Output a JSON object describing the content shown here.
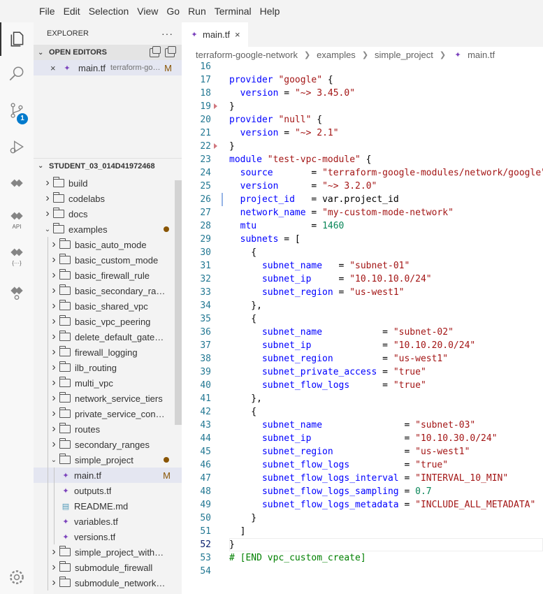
{
  "menu": [
    "File",
    "Edit",
    "Selection",
    "View",
    "Go",
    "Run",
    "Terminal",
    "Help"
  ],
  "activity": {
    "scm_badge": "1",
    "api_label": "API",
    "code_label": "{···}"
  },
  "explorer": {
    "title": "EXPLORER",
    "more": "···",
    "open_editors_title": "OPEN EDITORS",
    "open_editor": {
      "close": "×",
      "name": "main.tf",
      "desc": "terraform-google-network\\examples\\simple_project",
      "status": "M"
    },
    "project_title": "STUDENT_03_014D41972468"
  },
  "tree": [
    {
      "label": "build",
      "type": "folder",
      "depth": 0,
      "open": false
    },
    {
      "label": "codelabs",
      "type": "folder",
      "depth": 0,
      "open": false
    },
    {
      "label": "docs",
      "type": "folder",
      "depth": 0,
      "open": false
    },
    {
      "label": "examples",
      "type": "folder",
      "depth": 0,
      "open": true,
      "dot": true
    },
    {
      "label": "basic_auto_mode",
      "type": "folder",
      "depth": 1,
      "open": false
    },
    {
      "label": "basic_custom_mode",
      "type": "folder",
      "depth": 1,
      "open": false
    },
    {
      "label": "basic_firewall_rule",
      "type": "folder",
      "depth": 1,
      "open": false
    },
    {
      "label": "basic_secondary_ranges",
      "type": "folder",
      "depth": 1,
      "open": false
    },
    {
      "label": "basic_shared_vpc",
      "type": "folder",
      "depth": 1,
      "open": false
    },
    {
      "label": "basic_vpc_peering",
      "type": "folder",
      "depth": 1,
      "open": false
    },
    {
      "label": "delete_default_gateway_routes",
      "type": "folder",
      "depth": 1,
      "open": false
    },
    {
      "label": "firewall_logging",
      "type": "folder",
      "depth": 1,
      "open": false
    },
    {
      "label": "ilb_routing",
      "type": "folder",
      "depth": 1,
      "open": false
    },
    {
      "label": "multi_vpc",
      "type": "folder",
      "depth": 1,
      "open": false
    },
    {
      "label": "network_service_tiers",
      "type": "folder",
      "depth": 1,
      "open": false
    },
    {
      "label": "private_service_connect",
      "type": "folder",
      "depth": 1,
      "open": false
    },
    {
      "label": "routes",
      "type": "folder",
      "depth": 1,
      "open": false
    },
    {
      "label": "secondary_ranges",
      "type": "folder",
      "depth": 1,
      "open": false
    },
    {
      "label": "simple_project",
      "type": "folder",
      "depth": 1,
      "open": true,
      "dot": true
    },
    {
      "label": "main.tf",
      "type": "tf",
      "depth": 2,
      "selected": true,
      "status": "M"
    },
    {
      "label": "outputs.tf",
      "type": "tf",
      "depth": 2
    },
    {
      "label": "README.md",
      "type": "md",
      "depth": 2
    },
    {
      "label": "variables.tf",
      "type": "tf",
      "depth": 2
    },
    {
      "label": "versions.tf",
      "type": "tf",
      "depth": 2
    },
    {
      "label": "simple_project_with_regional_network",
      "type": "folder",
      "depth": 1,
      "open": false
    },
    {
      "label": "submodule_firewall",
      "type": "folder",
      "depth": 1,
      "open": false
    },
    {
      "label": "submodule_network_peering",
      "type": "folder",
      "depth": 1,
      "open": false
    }
  ],
  "tab": {
    "name": "main.tf",
    "close": "×"
  },
  "breadcrumb": [
    "terraform-google-network",
    "examples",
    "simple_project",
    "main.tf"
  ],
  "editor": {
    "current_line": 52,
    "lines": [
      {
        "n": "16",
        "tokens": []
      },
      {
        "n": "17",
        "tokens": [
          [
            "kw",
            "provider"
          ],
          [
            "t",
            " "
          ],
          [
            "str",
            "\"google\""
          ],
          [
            "t",
            " {"
          ]
        ]
      },
      {
        "n": "18",
        "tokens": [
          [
            "t",
            "  "
          ],
          [
            "prop",
            "version"
          ],
          [
            "t",
            " = "
          ],
          [
            "str",
            "\"~> 3.45.0\""
          ]
        ]
      },
      {
        "n": "19",
        "tokens": [
          [
            "t",
            "}"
          ]
        ],
        "fold": true
      },
      {
        "n": "20",
        "tokens": [
          [
            "kw",
            "provider"
          ],
          [
            "t",
            " "
          ],
          [
            "str",
            "\"null\""
          ],
          [
            "t",
            " {"
          ]
        ]
      },
      {
        "n": "21",
        "tokens": [
          [
            "t",
            "  "
          ],
          [
            "prop",
            "version"
          ],
          [
            "t",
            " = "
          ],
          [
            "str",
            "\"~> 2.1\""
          ]
        ]
      },
      {
        "n": "22",
        "tokens": [
          [
            "t",
            "}"
          ]
        ],
        "fold": true
      },
      {
        "n": "23",
        "tokens": [
          [
            "kw",
            "module"
          ],
          [
            "t",
            " "
          ],
          [
            "str",
            "\"test-vpc-module\""
          ],
          [
            "t",
            " {"
          ]
        ]
      },
      {
        "n": "24",
        "tokens": [
          [
            "t",
            "  "
          ],
          [
            "prop",
            "source"
          ],
          [
            "t",
            "       = "
          ],
          [
            "str",
            "\"terraform-google-modules/network/google\""
          ]
        ]
      },
      {
        "n": "25",
        "tokens": [
          [
            "t",
            "  "
          ],
          [
            "prop",
            "version"
          ],
          [
            "t",
            "      = "
          ],
          [
            "str",
            "\"~> 3.2.0\""
          ]
        ]
      },
      {
        "n": "26",
        "tokens": [
          [
            "t",
            "  "
          ],
          [
            "prop",
            "project_id"
          ],
          [
            "t",
            "   = var.project_id"
          ]
        ],
        "mod": true
      },
      {
        "n": "27",
        "tokens": [
          [
            "t",
            "  "
          ],
          [
            "prop",
            "network_name"
          ],
          [
            "t",
            " = "
          ],
          [
            "str",
            "\"my-custom-mode-network\""
          ]
        ]
      },
      {
        "n": "28",
        "tokens": [
          [
            "t",
            "  "
          ],
          [
            "prop",
            "mtu"
          ],
          [
            "t",
            "          = "
          ],
          [
            "num",
            "1460"
          ]
        ]
      },
      {
        "n": "29",
        "tokens": [
          [
            "t",
            "  "
          ],
          [
            "prop",
            "subnets"
          ],
          [
            "t",
            " = ["
          ]
        ]
      },
      {
        "n": "30",
        "tokens": [
          [
            "t",
            "    {"
          ]
        ]
      },
      {
        "n": "31",
        "tokens": [
          [
            "t",
            "      "
          ],
          [
            "prop",
            "subnet_name"
          ],
          [
            "t",
            "   = "
          ],
          [
            "str",
            "\"subnet-01\""
          ]
        ]
      },
      {
        "n": "32",
        "tokens": [
          [
            "t",
            "      "
          ],
          [
            "prop",
            "subnet_ip"
          ],
          [
            "t",
            "     = "
          ],
          [
            "str",
            "\"10.10.10.0/24\""
          ]
        ]
      },
      {
        "n": "33",
        "tokens": [
          [
            "t",
            "      "
          ],
          [
            "prop",
            "subnet_region"
          ],
          [
            "t",
            " = "
          ],
          [
            "str",
            "\"us-west1\""
          ]
        ]
      },
      {
        "n": "34",
        "tokens": [
          [
            "t",
            "    },"
          ]
        ]
      },
      {
        "n": "35",
        "tokens": [
          [
            "t",
            "    {"
          ]
        ]
      },
      {
        "n": "36",
        "tokens": [
          [
            "t",
            "      "
          ],
          [
            "prop",
            "subnet_name"
          ],
          [
            "t",
            "           = "
          ],
          [
            "str",
            "\"subnet-02\""
          ]
        ]
      },
      {
        "n": "37",
        "tokens": [
          [
            "t",
            "      "
          ],
          [
            "prop",
            "subnet_ip"
          ],
          [
            "t",
            "             = "
          ],
          [
            "str",
            "\"10.10.20.0/24\""
          ]
        ]
      },
      {
        "n": "38",
        "tokens": [
          [
            "t",
            "      "
          ],
          [
            "prop",
            "subnet_region"
          ],
          [
            "t",
            "         = "
          ],
          [
            "str",
            "\"us-west1\""
          ]
        ]
      },
      {
        "n": "39",
        "tokens": [
          [
            "t",
            "      "
          ],
          [
            "prop",
            "subnet_private_access"
          ],
          [
            "t",
            " = "
          ],
          [
            "str",
            "\"true\""
          ]
        ]
      },
      {
        "n": "40",
        "tokens": [
          [
            "t",
            "      "
          ],
          [
            "prop",
            "subnet_flow_logs"
          ],
          [
            "t",
            "      = "
          ],
          [
            "str",
            "\"true\""
          ]
        ]
      },
      {
        "n": "41",
        "tokens": [
          [
            "t",
            "    },"
          ]
        ]
      },
      {
        "n": "42",
        "tokens": [
          [
            "t",
            "    {"
          ]
        ]
      },
      {
        "n": "43",
        "tokens": [
          [
            "t",
            "      "
          ],
          [
            "prop",
            "subnet_name"
          ],
          [
            "t",
            "               = "
          ],
          [
            "str",
            "\"subnet-03\""
          ]
        ]
      },
      {
        "n": "44",
        "tokens": [
          [
            "t",
            "      "
          ],
          [
            "prop",
            "subnet_ip"
          ],
          [
            "t",
            "                 = "
          ],
          [
            "str",
            "\"10.10.30.0/24\""
          ]
        ]
      },
      {
        "n": "45",
        "tokens": [
          [
            "t",
            "      "
          ],
          [
            "prop",
            "subnet_region"
          ],
          [
            "t",
            "             = "
          ],
          [
            "str",
            "\"us-west1\""
          ]
        ]
      },
      {
        "n": "46",
        "tokens": [
          [
            "t",
            "      "
          ],
          [
            "prop",
            "subnet_flow_logs"
          ],
          [
            "t",
            "          = "
          ],
          [
            "str",
            "\"true\""
          ]
        ]
      },
      {
        "n": "47",
        "tokens": [
          [
            "t",
            "      "
          ],
          [
            "prop",
            "subnet_flow_logs_interval"
          ],
          [
            "t",
            " = "
          ],
          [
            "str",
            "\"INTERVAL_10_MIN\""
          ]
        ]
      },
      {
        "n": "48",
        "tokens": [
          [
            "t",
            "      "
          ],
          [
            "prop",
            "subnet_flow_logs_sampling"
          ],
          [
            "t",
            " = "
          ],
          [
            "num",
            "0.7"
          ]
        ]
      },
      {
        "n": "49",
        "tokens": [
          [
            "t",
            "      "
          ],
          [
            "prop",
            "subnet_flow_logs_metadata"
          ],
          [
            "t",
            " = "
          ],
          [
            "str",
            "\"INCLUDE_ALL_METADATA\""
          ]
        ]
      },
      {
        "n": "50",
        "tokens": [
          [
            "t",
            "    }"
          ]
        ]
      },
      {
        "n": "51",
        "tokens": [
          [
            "t",
            "  ]"
          ]
        ]
      },
      {
        "n": "52",
        "tokens": [
          [
            "t",
            "}"
          ]
        ]
      },
      {
        "n": "53",
        "tokens": [
          [
            "cmt",
            "# [END vpc_custom_create]"
          ]
        ]
      },
      {
        "n": "54",
        "tokens": []
      }
    ]
  }
}
